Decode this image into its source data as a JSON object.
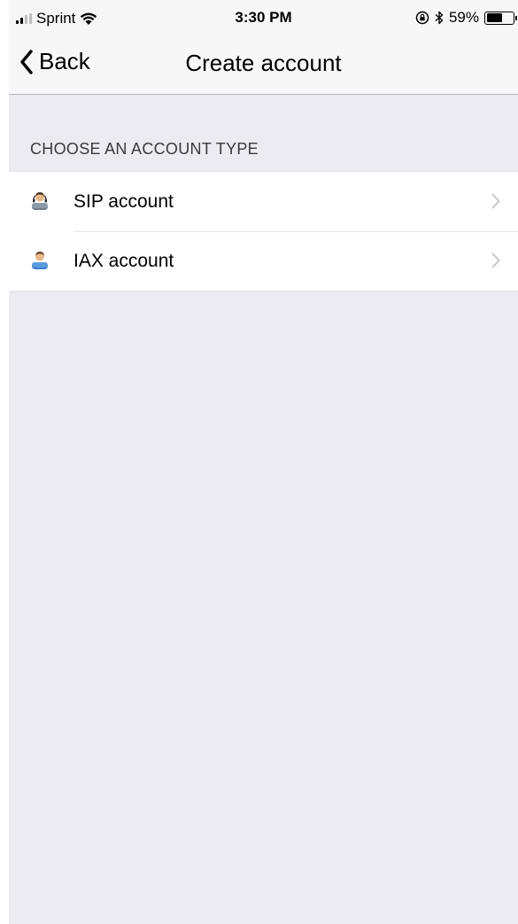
{
  "status_bar": {
    "carrier": "Sprint",
    "time": "3:30 PM",
    "battery_percent": "59%",
    "battery_level": 0.59,
    "icons": [
      "signal-icon",
      "wifi-icon",
      "orientation-lock-icon",
      "bluetooth-icon",
      "battery-icon"
    ]
  },
  "nav": {
    "back_label": "Back",
    "title": "Create account"
  },
  "section": {
    "header": "CHOOSE AN ACCOUNT TYPE"
  },
  "accounts": [
    {
      "label": "SIP account",
      "icon": "user-icon"
    },
    {
      "label": "IAX account",
      "icon": "user-icon"
    }
  ],
  "colors": {
    "background": "#ECEBF1",
    "bar": "#F7F7F8",
    "cell": "#FFFFFF",
    "separator": "#E3E3E8",
    "chevron": "#C7C7CC"
  }
}
